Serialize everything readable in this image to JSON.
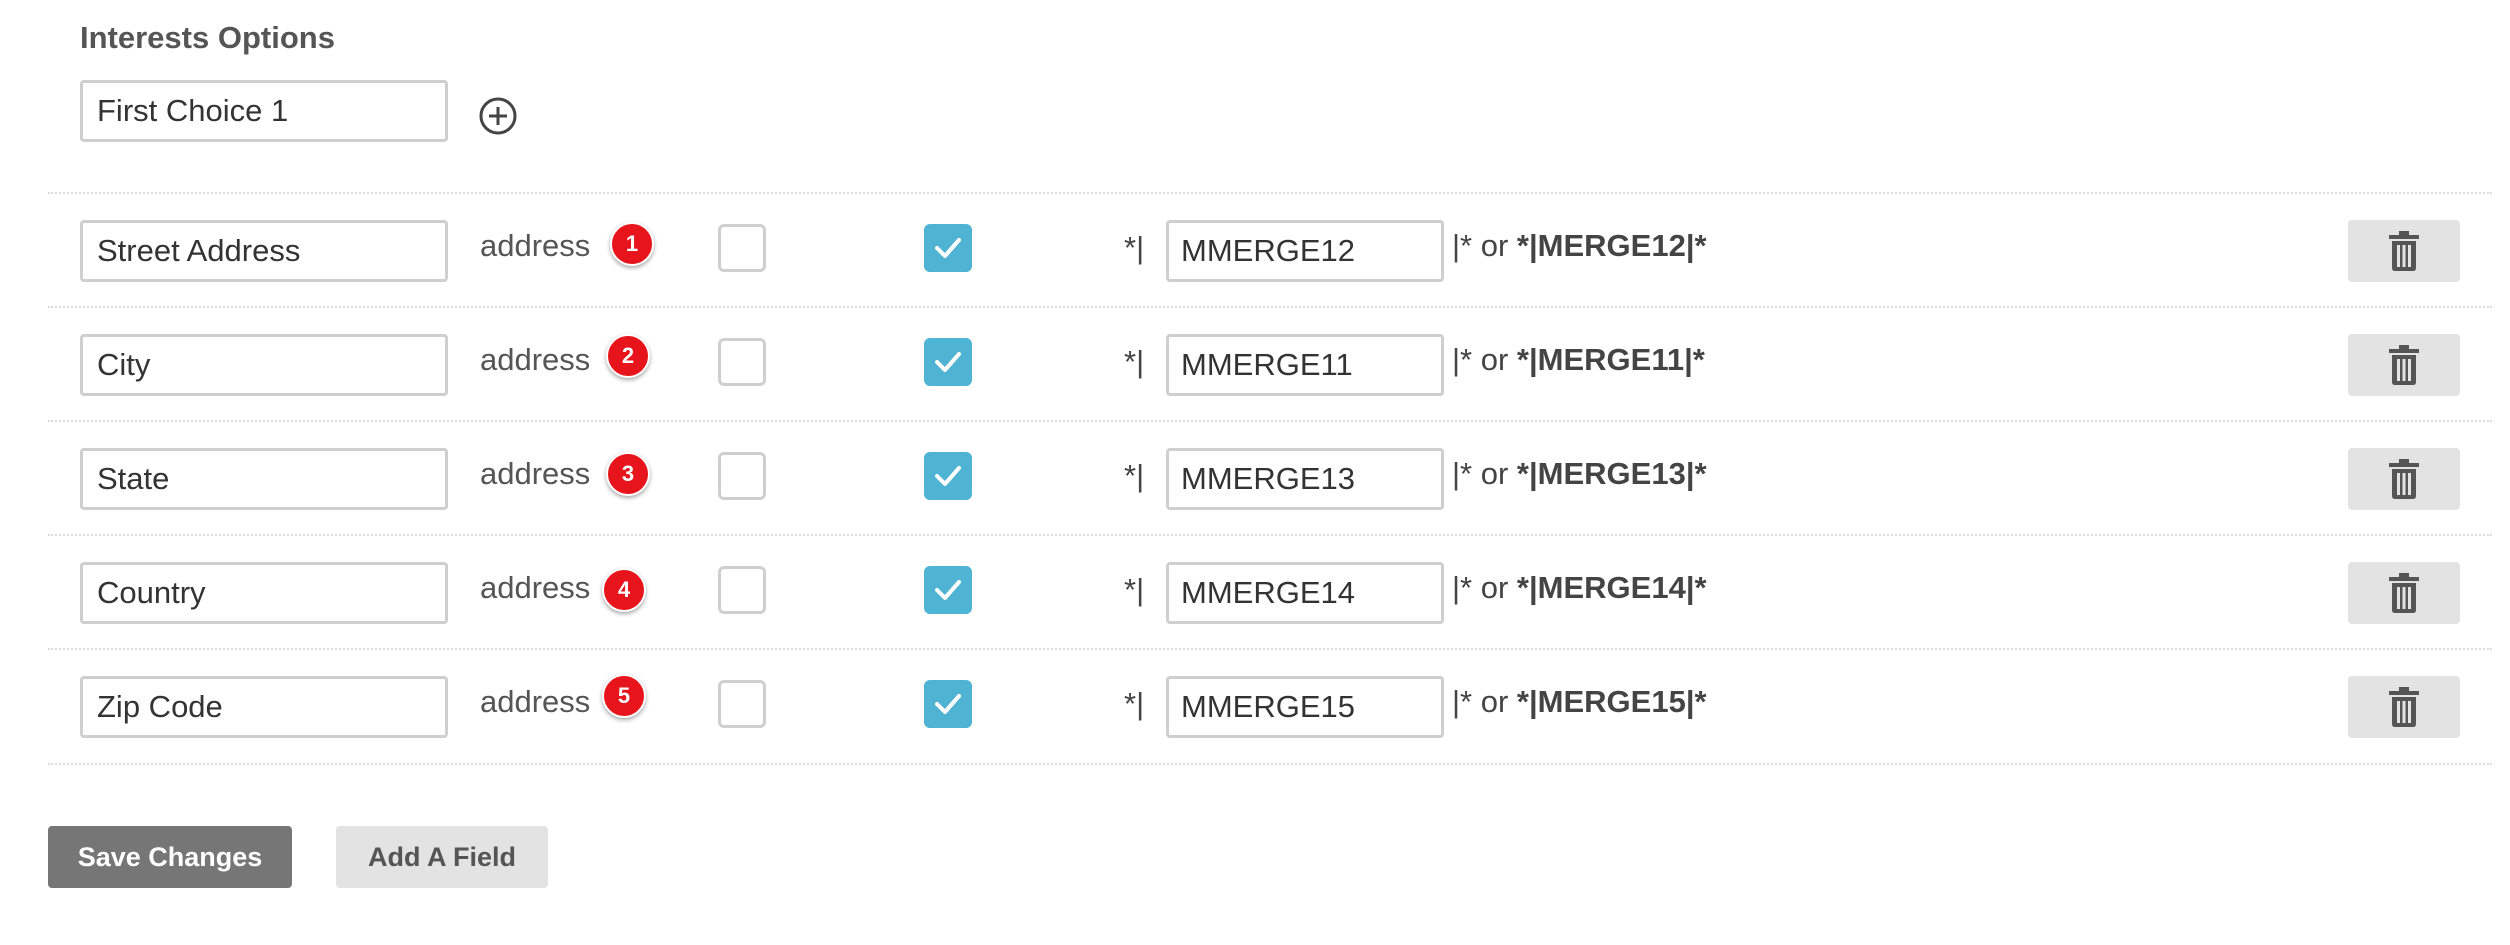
{
  "interests": {
    "label": "Interests Options",
    "first_choice_value": "First Choice 1",
    "add_choice_icon": "plus-circle-icon"
  },
  "fields": [
    {
      "name": "Street Address",
      "type": "address",
      "badge": "1",
      "required": false,
      "visible": true,
      "merge_prefix": "*|",
      "merge_tag": "MMERGE12",
      "merge_suffix": "|* or",
      "merge_alt": "*|MERGE12|*"
    },
    {
      "name": "City",
      "type": "address",
      "badge": "2",
      "required": false,
      "visible": true,
      "merge_prefix": "*|",
      "merge_tag": "MMERGE11",
      "merge_suffix": "|* or",
      "merge_alt": "*|MERGE11|*"
    },
    {
      "name": "State",
      "type": "address",
      "badge": "3",
      "required": false,
      "visible": true,
      "merge_prefix": "*|",
      "merge_tag": "MMERGE13",
      "merge_suffix": "|* or",
      "merge_alt": "*|MERGE13|*"
    },
    {
      "name": "Country",
      "type": "address",
      "badge": "4",
      "required": false,
      "visible": true,
      "merge_prefix": "*|",
      "merge_tag": "MMERGE14",
      "merge_suffix": "|* or",
      "merge_alt": "*|MERGE14|*"
    },
    {
      "name": "Zip Code",
      "type": "address",
      "badge": "5",
      "required": false,
      "visible": true,
      "merge_prefix": "*|",
      "merge_tag": "MMERGE15",
      "merge_suffix": "|* or",
      "merge_alt": "*|MERGE15|*"
    }
  ],
  "actions": {
    "save_label": "Save Changes",
    "add_field_label": "Add A Field"
  },
  "colors": {
    "checked_accent": "#4fb3d3",
    "badge_red": "#e8141b",
    "save_button": "#767676",
    "secondary_button": "#e3e3e3"
  },
  "icons": {
    "delete": "trash-icon",
    "check": "check-icon"
  }
}
